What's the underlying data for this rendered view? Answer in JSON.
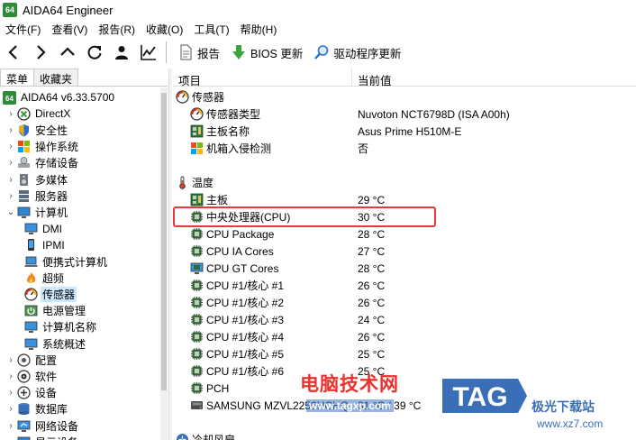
{
  "window": {
    "title": "AIDA64 Engineer",
    "logo_text": "64"
  },
  "menu": [
    "文件(F)",
    "查看(V)",
    "报告(R)",
    "收藏(O)",
    "工具(T)",
    "帮助(H)"
  ],
  "toolbar": {
    "report": "报告",
    "bios_update": "BIOS 更新",
    "driver_update": "驱动程序更新"
  },
  "left_tabs": [
    "菜单",
    "收藏夹"
  ],
  "tree": [
    {
      "label": "AIDA64 v6.33.5700",
      "icon": "aida64-logo-icon",
      "indent": 0,
      "chev": ""
    },
    {
      "label": "DirectX",
      "icon": "directx-icon",
      "indent": 1,
      "chev": "›"
    },
    {
      "label": "安全性",
      "icon": "shield-icon",
      "indent": 1,
      "chev": "›"
    },
    {
      "label": "操作系统",
      "icon": "windows-icon",
      "indent": 1,
      "chev": "›"
    },
    {
      "label": "存储设备",
      "icon": "storage-icon",
      "indent": 1,
      "chev": "›"
    },
    {
      "label": "多媒体",
      "icon": "speaker-icon",
      "indent": 1,
      "chev": "›"
    },
    {
      "label": "服务器",
      "icon": "server-icon",
      "indent": 1,
      "chev": "›"
    },
    {
      "label": "计算机",
      "icon": "computer-icon",
      "indent": 1,
      "chev": "⌄"
    },
    {
      "label": "DMI",
      "icon": "monitor-icon",
      "indent": 2,
      "chev": ""
    },
    {
      "label": "IPMI",
      "icon": "phone-icon",
      "indent": 2,
      "chev": ""
    },
    {
      "label": "便携式计算机",
      "icon": "laptop-icon",
      "indent": 2,
      "chev": ""
    },
    {
      "label": "超频",
      "icon": "flame-icon",
      "indent": 2,
      "chev": ""
    },
    {
      "label": "传感器",
      "icon": "gauge-icon",
      "indent": 2,
      "chev": "",
      "selected": true
    },
    {
      "label": "电源管理",
      "icon": "power-icon",
      "indent": 2,
      "chev": ""
    },
    {
      "label": "计算机名称",
      "icon": "monitor-icon",
      "indent": 2,
      "chev": ""
    },
    {
      "label": "系统概述",
      "icon": "monitor-icon",
      "indent": 2,
      "chev": ""
    },
    {
      "label": "配置",
      "icon": "config-icon",
      "indent": 1,
      "chev": "›"
    },
    {
      "label": "软件",
      "icon": "software-icon",
      "indent": 1,
      "chev": "›"
    },
    {
      "label": "设备",
      "icon": "devices-icon",
      "indent": 1,
      "chev": "›"
    },
    {
      "label": "数据库",
      "icon": "database-icon",
      "indent": 1,
      "chev": "›"
    },
    {
      "label": "网络设备",
      "icon": "network-icon",
      "indent": 1,
      "chev": "›"
    },
    {
      "label": "显示设备",
      "icon": "display-icon",
      "indent": 1,
      "chev": "›"
    }
  ],
  "columns": {
    "item": "项目",
    "value": "当前值"
  },
  "sections": {
    "sensor": "传感器",
    "temperature": "温度",
    "cooling": "冷却风扇"
  },
  "sensor_rows": [
    {
      "label": "传感器类型",
      "value": "Nuvoton NCT6798D  (ISA A00h)",
      "icon": "gauge-icon"
    },
    {
      "label": "主板名称",
      "value": "Asus Prime H510M-E",
      "icon": "motherboard-icon"
    },
    {
      "label": "机箱入侵检测",
      "value": "否",
      "icon": "windows-icon"
    }
  ],
  "temp_rows": [
    {
      "label": "主板",
      "value": "29 °C",
      "icon": "motherboard-icon"
    },
    {
      "label": "中央处理器(CPU)",
      "value": "30 °C",
      "icon": "chip-icon"
    },
    {
      "label": "CPU Package",
      "value": "28 °C",
      "icon": "chip-icon"
    },
    {
      "label": "CPU IA Cores",
      "value": "27 °C",
      "icon": "chip-icon"
    },
    {
      "label": "CPU GT Cores",
      "value": "28 °C",
      "icon": "gpu-icon"
    },
    {
      "label": "CPU #1/核心 #1",
      "value": "26 °C",
      "icon": "chip-icon"
    },
    {
      "label": "CPU #1/核心 #2",
      "value": "26 °C",
      "icon": "chip-icon"
    },
    {
      "label": "CPU #1/核心 #3",
      "value": "24 °C",
      "icon": "chip-icon"
    },
    {
      "label": "CPU #1/核心 #4",
      "value": "26 °C",
      "icon": "chip-icon"
    },
    {
      "label": "CPU #1/核心 #5",
      "value": "25 °C",
      "icon": "chip-icon"
    },
    {
      "label": "CPU #1/核心 #6",
      "value": "25 °C",
      "icon": "chip-icon"
    },
    {
      "label": "PCH",
      "value": "",
      "icon": "chip-icon"
    },
    {
      "label": "SAMSUNG MZVL2256HCHQ",
      "value": "31 °C / 39 °C",
      "icon": "drive-icon"
    }
  ],
  "watermark": {
    "text": "电脑技术网",
    "url": "www.tagxp.com",
    "tag": "TAG",
    "site1": "极光下载站",
    "site2": "www.xz7.com"
  },
  "colors": {
    "highlight": "#e23b3b",
    "selected": "#cce8ff",
    "watermark_red": "#e8322d",
    "watermark_blue": "#3a6fb7"
  }
}
